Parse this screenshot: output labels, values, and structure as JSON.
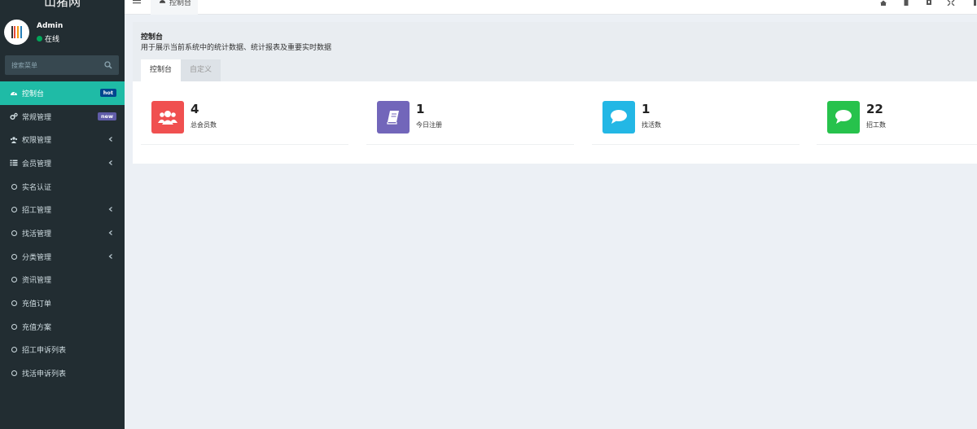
{
  "app": {
    "title": "山猪网"
  },
  "user": {
    "name": "Admin",
    "status": "在线"
  },
  "search": {
    "placeholder": "搜索菜单"
  },
  "menu": [
    {
      "label": "控制台",
      "icon": "dashboard-icon",
      "badge": "hot",
      "badge_color": "#00478f",
      "active": true
    },
    {
      "label": "常规管理",
      "icon": "cogs-icon",
      "badge": "new",
      "badge_color": "#605ca8"
    },
    {
      "label": "权限管理",
      "icon": "group-icon",
      "chevron": true
    },
    {
      "label": "会员管理",
      "icon": "list-icon",
      "chevron": true
    },
    {
      "label": "实名认证",
      "icon": "circle-icon"
    },
    {
      "label": "招工管理",
      "icon": "circle-icon",
      "chevron": true
    },
    {
      "label": "找活管理",
      "icon": "circle-icon",
      "chevron": true
    },
    {
      "label": "分类管理",
      "icon": "circle-icon",
      "chevron": true
    },
    {
      "label": "资讯管理",
      "icon": "circle-icon"
    },
    {
      "label": "充值订单",
      "icon": "circle-icon"
    },
    {
      "label": "充值方案",
      "icon": "circle-icon"
    },
    {
      "label": "招工申诉列表",
      "icon": "circle-icon"
    },
    {
      "label": "找活申诉列表",
      "icon": "circle-icon"
    }
  ],
  "header": {
    "tab_label": "控制台"
  },
  "panel": {
    "title": "控制台",
    "subtitle": "用于展示当前系统中的统计数据、统计报表及重要实时数据",
    "tabs": [
      "控制台",
      "自定义"
    ]
  },
  "stats": [
    {
      "value": "4",
      "label": "总会员数",
      "color": "#f05050",
      "icon": "users-icon"
    },
    {
      "value": "1",
      "label": "今日注册",
      "color": "#7266ba",
      "icon": "book-icon"
    },
    {
      "value": "1",
      "label": "找活数",
      "color": "#23b7e5",
      "icon": "comment-icon"
    },
    {
      "value": "22",
      "label": "招工数",
      "color": "#27c24c",
      "icon": "comment-icon"
    }
  ],
  "colors": {
    "sidebar": "#222d32",
    "accent": "#1fbba6",
    "background": "#ecf0f5"
  }
}
